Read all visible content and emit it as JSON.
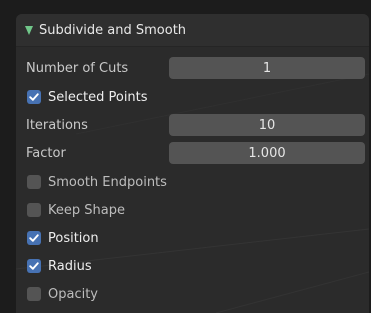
{
  "panel": {
    "title": "Subdivide and Smooth",
    "expanded": true,
    "accent_color": "#71c78a",
    "checkbox_on_color": "#4772b3"
  },
  "fields": {
    "number_of_cuts": {
      "label": "Number of Cuts",
      "value": "1"
    },
    "iterations": {
      "label": "Iterations",
      "value": "10"
    },
    "factor": {
      "label": "Factor",
      "value": "1.000"
    }
  },
  "checkboxes": {
    "selected_points": {
      "label": "Selected Points",
      "checked": true
    },
    "smooth_endpoints": {
      "label": "Smooth Endpoints",
      "checked": false
    },
    "keep_shape": {
      "label": "Keep Shape",
      "checked": false
    },
    "position": {
      "label": "Position",
      "checked": true
    },
    "radius": {
      "label": "Radius",
      "checked": true
    },
    "opacity": {
      "label": "Opacity",
      "checked": false
    }
  }
}
